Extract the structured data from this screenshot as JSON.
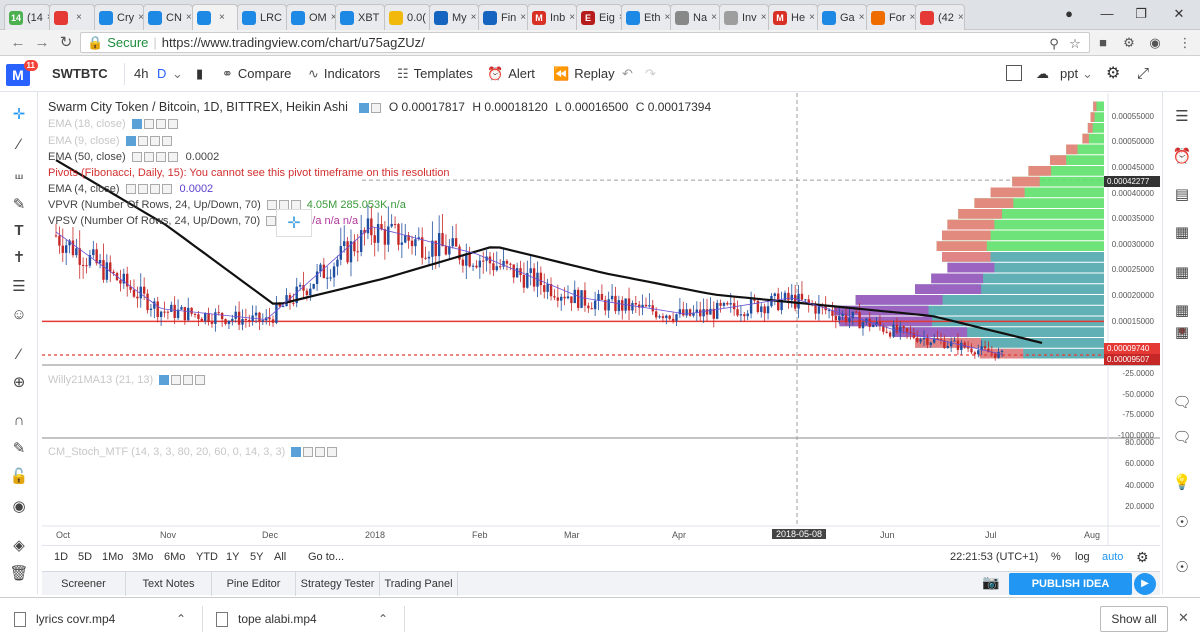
{
  "browser": {
    "tabs": [
      {
        "label": "(14",
        "favicon_text": "14",
        "favicon_color": "#4caf50"
      },
      {
        "label": "",
        "favicon_text": "",
        "favicon_color": "#e53935"
      },
      {
        "label": "Cry",
        "favicon_text": "",
        "favicon_color": "#1e88e5"
      },
      {
        "label": "CN",
        "favicon_text": "",
        "favicon_color": "#1e88e5"
      },
      {
        "label": "",
        "favicon_text": "",
        "favicon_color": "#1e88e5"
      },
      {
        "label": "LRC",
        "favicon_text": "",
        "favicon_color": "#1e88e5"
      },
      {
        "label": "OM",
        "favicon_text": "",
        "favicon_color": "#1e88e5"
      },
      {
        "label": "XBT",
        "favicon_text": "",
        "favicon_color": "#1e88e5"
      },
      {
        "label": "0.0(",
        "favicon_text": "",
        "favicon_color": "#f0b90b"
      },
      {
        "label": "My",
        "favicon_text": "",
        "favicon_color": "#1565c0"
      },
      {
        "label": "Fin",
        "favicon_text": "",
        "favicon_color": "#1565c0"
      },
      {
        "label": "Inb",
        "favicon_text": "M",
        "favicon_color": "#d93025"
      },
      {
        "label": "Eig",
        "favicon_text": "E",
        "favicon_color": "#b71c1c"
      },
      {
        "label": "Eth",
        "favicon_text": "",
        "favicon_color": "#1e88e5"
      },
      {
        "label": "Na",
        "favicon_text": "",
        "favicon_color": "#888888"
      },
      {
        "label": "Inv",
        "favicon_text": "",
        "favicon_color": "#9e9e9e"
      },
      {
        "label": "He",
        "favicon_text": "M",
        "favicon_color": "#d93025"
      },
      {
        "label": "Ga",
        "favicon_text": "",
        "favicon_color": "#1e88e5"
      },
      {
        "label": "For",
        "favicon_text": "",
        "favicon_color": "#ef6c00"
      },
      {
        "label": "(42",
        "favicon_text": "",
        "favicon_color": "#e53935"
      }
    ],
    "url": {
      "secure_label": "Secure",
      "full": "https://www.tradingview.com/chart/u75agZUz/"
    }
  },
  "header": {
    "symbol": "SWTBTC",
    "interval": "4h",
    "interval_selected": "D",
    "compare": "Compare",
    "indicators": "Indicators",
    "templates": "Templates",
    "alert": "Alert",
    "replay": "Replay",
    "layout_name": "ppt",
    "logo_letter": "M",
    "notification_count": "11"
  },
  "chart": {
    "title": "Swarm City Token / Bitcoin, 1D, BITTREX, Heikin Ashi",
    "ohlc": {
      "open": "O 0.00017817",
      "high": "H 0.00018120",
      "low": "L 0.00016500",
      "close": "C 0.00017394"
    },
    "legend": {
      "ema18": "EMA (18, close)",
      "ema9": "EMA (9, close)",
      "ema50": "EMA (50, close)",
      "ema50_value": "0.0002",
      "pivots": "Pivots (Fibonacci, Daily, 15): You cannot see this pivot timeframe on this resolution",
      "ema4": "EMA (4, close)",
      "ema4_value": "0.0002",
      "vpvr": "VPVR (Number Of Rows, 24, Up/Down, 70)",
      "vpvr_values": "4.05M  285.053K  n/a",
      "vpsv": "VPSV (Number Of Rows, 24, Up/Down, 70)",
      "vpsv_values": "n/a  n/a  n/a",
      "williams": "Willy21MA13 (21, 13)",
      "stoch": "CM_Stoch_MTF (14, 3, 3, 80, 20, 60, 0, 14, 3, 3)"
    },
    "price_labels": {
      "current": "0.00042277",
      "level1": "0.00009740",
      "level2": "0.00009507"
    },
    "y_axis_main": [
      "0.00055000",
      "0.00050000",
      "0.00045000",
      "0.00040000",
      "0.00035000",
      "0.00030000",
      "0.00025000",
      "0.00020000",
      "0.00015000"
    ],
    "y_axis_w": [
      "-25.0000",
      "-50.0000",
      "-75.0000",
      "-100.0000"
    ],
    "y_axis_stoch": [
      "80.0000",
      "60.0000",
      "40.0000",
      "20.0000"
    ],
    "x_axis": [
      "Oct",
      "Nov",
      "Dec",
      "2018",
      "Feb",
      "Mar",
      "Apr",
      "Jun",
      "Jul",
      "Aug"
    ],
    "crosshair_date": "2018-05-08"
  },
  "chart_data": {
    "type": "candlestick",
    "title": "Swarm City Token / Bitcoin, 1D, BITTREX, Heikin Ashi",
    "xlabel": "",
    "ylabel": "",
    "ylim": [
      9e-05,
      0.00057
    ],
    "x": [
      "Oct",
      "Nov",
      "Dec",
      "2018",
      "Feb",
      "Mar",
      "Apr",
      "May",
      "Jun",
      "Jul"
    ],
    "series": [
      {
        "name": "close",
        "values": [
          0.00032,
          0.00018,
          0.00016,
          0.00033,
          0.00028,
          0.0002,
          0.00017,
          0.0002,
          0.00014,
          9.7e-05
        ]
      },
      {
        "name": "EMA (50, close)",
        "values": [
          0.00046,
          0.00034,
          0.00019,
          0.00024,
          0.0003,
          0.00025,
          0.00021,
          0.00019,
          0.00017,
          0.00012
        ]
      }
    ],
    "horizontal_lines": [
      0.00016,
      9.74e-05
    ],
    "grid": true
  },
  "rangebar": {
    "buttons": [
      "1D",
      "5D",
      "1Mo",
      "3Mo",
      "6Mo",
      "YTD",
      "1Y",
      "5Y",
      "All"
    ],
    "goto": "Go to...",
    "time": "22:21:53 (UTC+1)",
    "percent": "%",
    "log": "log",
    "auto": "auto"
  },
  "bottom": {
    "tabs": [
      "Screener",
      "Text Notes",
      "Pine Editor",
      "Strategy Tester",
      "Trading Panel"
    ],
    "publish": "PUBLISH IDEA"
  },
  "downloads": {
    "items": [
      "lyrics covr.mp4",
      "tope alabi.mp4"
    ],
    "show_all": "Show all"
  },
  "colors": {
    "accent": "#2196f3",
    "bear": "#c62828",
    "bull": "#1e4fa0",
    "ema50": "#111111",
    "support_line": "#e53935",
    "vp_green": "#5ee06a",
    "vp_teal": "#4fa7ad",
    "vp_purple": "#a25cc1",
    "vp_pink": "#f08080"
  }
}
